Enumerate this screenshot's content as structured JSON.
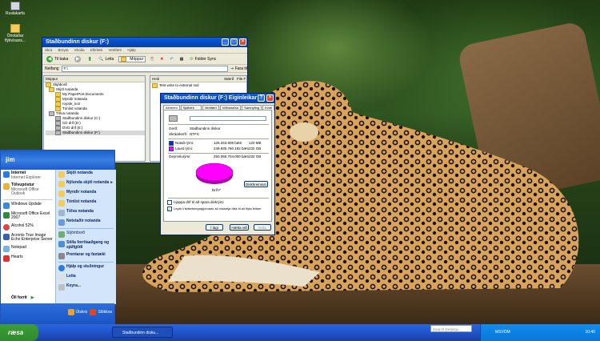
{
  "desktop": {
    "icons": [
      {
        "label": "Ruslakarfa",
        "icon": "recycle-bin-icon"
      },
      {
        "label": "Ónotaðar flýtivísans...",
        "icon": "folder-icon"
      }
    ]
  },
  "explorer": {
    "title": "Staðbundinn diskur (F:)",
    "menu": [
      "Skrá",
      "Breyta",
      "Skoða",
      "Eftirlæti",
      "Verkfæri",
      "Hjálp"
    ],
    "toolbar": {
      "back": "Til baka",
      "search": "Leita",
      "folders": "Möppur",
      "folder_sync": "Folder Sync"
    },
    "address_label": "Netfang",
    "address_value": "F:\\",
    "go_label": "Fara til",
    "folders_header": "Möppur",
    "tree": [
      "Skjáborð",
      "Skjöl notanda",
      "My PaperPort Documents",
      "Myndir notanda",
      "royale_noir",
      "Tónlist notanda",
      "Tölva notanda",
      "Staðbundinn diskur (C:)",
      "CD drif (D:)",
      "DVD drif (E:)",
      "Staðbundinn diskur (F:)"
    ],
    "columns": {
      "name": "Heiti",
      "size": "Stærð",
      "type": "File F"
    },
    "files": [
      {
        "name": "Test write to external ssd"
      }
    ]
  },
  "properties": {
    "title": "Staðbundinn diskur (F:) Eiginleikar",
    "tabs": [
      "Almennt",
      "Sjálfvirk spilun",
      "Verkfæri",
      "Vélbúnaður",
      "Samnýting",
      "Kvóti"
    ],
    "type_label": "Gerð:",
    "type_value": "Staðbundinn diskur",
    "fs_label": "Skráarkerfi:",
    "fs_value": "NTFS",
    "used_label": "Notað rými:",
    "used_bytes": "125.343.808 bæti",
    "used_size": "120 MB",
    "free_label": "Laust rými:",
    "free_bytes": "249.935.760.192 bæti",
    "free_size": "232 GB",
    "cap_label": "Geymslurými:",
    "cap_bytes": "250.056.704.000 bæti",
    "cap_size": "232 GB",
    "drive_label": "Drif F",
    "cleanup": "Diskhreinsun",
    "compress": "Þjappa drif til að spara diskrými",
    "index": "Leyfa Vísitsetningarþjónustu að vísisetja disk til að flýta leitum",
    "ok": "Í lagi",
    "cancel": "Hætta við",
    "apply": "Nota",
    "colors": {
      "used": "#2020d0",
      "free": "#ff00ff"
    }
  },
  "startmenu": {
    "user": "jim",
    "left": [
      {
        "title": "Internet",
        "sub": "Internet Explorer",
        "icon": "ie-icon"
      },
      {
        "title": "Tölvupóstur",
        "sub": "Microsoft Office Outlook",
        "icon": "outlook-icon"
      },
      {
        "title": "Windows Update",
        "sub": "",
        "icon": "windows-icon"
      },
      {
        "title": "Microsoft Office Excel 2007",
        "sub": "",
        "icon": "excel-icon"
      },
      {
        "title": "Alcohol 52%",
        "sub": "",
        "icon": "disc-icon"
      },
      {
        "title": "Acronis True Image Echo Enterprise Server",
        "sub": "",
        "icon": "acronis-icon"
      },
      {
        "title": "Notepad",
        "sub": "",
        "icon": "notepad-icon"
      },
      {
        "title": "Hearts",
        "sub": "",
        "icon": "hearts-icon"
      }
    ],
    "all_programs": "Öll forrit",
    "right": [
      {
        "label": "Skjöl notanda",
        "icon": "documents-icon"
      },
      {
        "label": "Nýlunda skjöl notanda",
        "icon": "recent-icon"
      },
      {
        "label": "Myndir notanda",
        "icon": "pictures-icon"
      },
      {
        "label": "Tónlist notanda",
        "icon": "music-icon"
      },
      {
        "label": "Tölva notanda",
        "icon": "computer-icon"
      },
      {
        "label": "Netstaðir notanda",
        "icon": "network-icon"
      },
      {
        "label": "Stjórnborð",
        "icon": "control-panel-icon"
      },
      {
        "label": "Stilla forritaaðgang og sjálfgildi",
        "icon": "defaults-icon"
      },
      {
        "label": "Prentarar og faxtæki",
        "icon": "printer-icon"
      },
      {
        "label": "Hjálp og stuðningur",
        "icon": "help-icon"
      },
      {
        "label": "Leita",
        "icon": "search-icon"
      },
      {
        "label": "Keyra...",
        "icon": "run-icon"
      }
    ],
    "logoff": "Útskrá",
    "shutdown": "Slökkva"
  },
  "taskbar": {
    "start": "ræsa",
    "task": "Staðbundinn disku...",
    "search_placeholder": "Search Desktop",
    "tray_label": "MSVDM",
    "time": "10:40"
  }
}
